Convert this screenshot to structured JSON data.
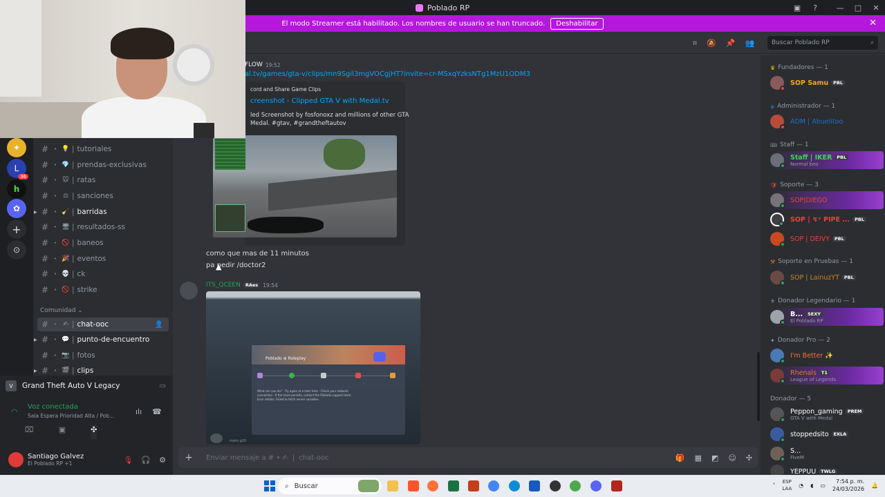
{
  "window": {
    "title": "Poblado RP"
  },
  "banner": {
    "text": "El modo Streamer está habilitado. Los nombres de usuario se han truncado.",
    "button": "Deshabilitar"
  },
  "rail": {
    "badge": "36"
  },
  "channels": [
    {
      "name": "tutoriales",
      "emoji": "💡",
      "bold": false
    },
    {
      "name": "prendas-exclusivas",
      "emoji": "💎",
      "bold": false
    },
    {
      "name": "ratas",
      "emoji": "🐭",
      "bold": false
    },
    {
      "name": "sanciones",
      "emoji": "⚖",
      "bold": false
    },
    {
      "name": "barridas",
      "emoji": "🧹",
      "bold": true
    },
    {
      "name": "resultados-ss",
      "emoji": "🖥",
      "bold": false
    },
    {
      "name": "baneos",
      "emoji": "🚫",
      "bold": false
    },
    {
      "name": "eventos",
      "emoji": "🎉",
      "bold": false
    },
    {
      "name": "ck",
      "emoji": "💀",
      "bold": false
    },
    {
      "name": "strike",
      "emoji": "🚫",
      "bold": false
    }
  ],
  "community": {
    "label": "Comunidad",
    "channels": [
      {
        "name": "chat-ooc",
        "emoji": "✍",
        "selected": true
      },
      {
        "name": "punto-de-encuentro",
        "emoji": "💬",
        "selected": false
      },
      {
        "name": "fotos",
        "emoji": "📷",
        "selected": false
      },
      {
        "name": "clips",
        "emoji": "🎬",
        "selected": false
      }
    ]
  },
  "game": {
    "name": "Grand Theft Auto V Legacy"
  },
  "voice": {
    "status": "Voz conectada",
    "channel": "Sala Espera Prioridad Alta / Pob..."
  },
  "user": {
    "name": "Santiago Galvez",
    "status": "El Poblado RP +1"
  },
  "header": {
    "search_placeholder": "Buscar Poblado RP"
  },
  "messages": {
    "m1": {
      "author": "FLOW",
      "time": "19:52",
      "link": "al.tv/games/gta-v/clips/mn9Sgil3mgVOCgjHT?invite=cr-MSxqYzksNTg1MzU1ODM3",
      "embed_provider": "cord and Share Game Clips",
      "embed_title": "creenshot - Clipped GTA V with Medal.tv",
      "embed_desc": "led Screenshot by fosfonoxz and millions of other GTA Medal. #gtav, #grandtheftautov"
    },
    "m1_text": [
      "como que mas de 11 minutos",
      "pa pedir /doctor2"
    ],
    "m2": {
      "author": "ITS_QCEEN",
      "role": "RAes",
      "time": "19:54",
      "shot_title": "Poblado ⊕ Roleplay",
      "shot_text": "What can you do? · Try again at a later time · Check your network connection · If the issue persists, contact the Poblado support team. Error details: Failed to fetch server variables.",
      "shot_caption": "meto g20"
    }
  },
  "input": {
    "placeholder": "Enviar mensaje a #",
    "channel": "chat-ooc",
    "channel_emoji": "✍"
  },
  "members": [
    {
      "role": "Fundadores — 1",
      "role_icon": "♛",
      "items": [
        {
          "name": "SOP Samu",
          "color": "#f5a623",
          "tag": "PBL",
          "sub": ""
        }
      ]
    },
    {
      "role": "Administrador — 1",
      "role_icon": "◈",
      "items": [
        {
          "name": "ADM | Abuelitoo",
          "color": "#1e6fd0",
          "tag": "",
          "sub": ""
        }
      ]
    },
    {
      "role": "Staff — 1",
      "role_icon": "🎟",
      "items": [
        {
          "name": "Staff | IKER",
          "color": "#3ad94d",
          "tag": "PBL",
          "sub": "Normal beo",
          "glow": true
        }
      ]
    },
    {
      "role": "Soporte — 3",
      "role_icon": "🛡",
      "items": [
        {
          "name": "SOP|DIEGO",
          "color": "#e9443a",
          "tag": "",
          "sub": "",
          "glow": true
        },
        {
          "name": "SOP | ↯ᵛ PIPE ...",
          "color": "#e9443a",
          "tag": "PBL",
          "sub": ""
        },
        {
          "name": "SOP | DEIVY",
          "color": "#e9443a",
          "tag": "PBL",
          "sub": ""
        }
      ]
    },
    {
      "role": "Soporte en Pruebas — 1",
      "role_icon": "⚒",
      "items": [
        {
          "name": "SOP | LainuzYT",
          "color": "#c7871f",
          "tag": "PBL",
          "sub": ""
        }
      ]
    },
    {
      "role": "Donador Legendario — 1",
      "role_icon": "⚜",
      "items": [
        {
          "name": "B...",
          "color": "#ffffff",
          "tag": "SEXY",
          "sub": "El Poblado RP",
          "glow": true
        }
      ]
    },
    {
      "role": "Donador Pro — 2",
      "role_icon": "✦",
      "items": [
        {
          "name": "I'm Better ✨",
          "color": "#ff6b3d",
          "tag": "",
          "sub": ""
        },
        {
          "name": "Rhenals",
          "color": "#e07a2a",
          "tag": "T1",
          "sub": "League of Legends",
          "glow": true
        }
      ]
    },
    {
      "role": "Donador — 5",
      "role_icon": "",
      "items": [
        {
          "name": "Peppon_gaming",
          "color": "#ffffff",
          "tag": "PREM",
          "sub": "GTA V with Medal"
        },
        {
          "name": "stoppedsito",
          "color": "#ffffff",
          "tag": "EXLA",
          "sub": ""
        },
        {
          "name": "S...",
          "color": "#ffffff",
          "tag": "",
          "sub": "FiveM"
        },
        {
          "name": "YEPPUU",
          "color": "#ffffff",
          "tag": "TWLG",
          "sub": ""
        }
      ]
    }
  ],
  "taskbar": {
    "search": "Buscar",
    "lang": "ESP",
    "lang2": "LAA",
    "time": "7:54 p. m.",
    "date": "24/03/2026"
  }
}
